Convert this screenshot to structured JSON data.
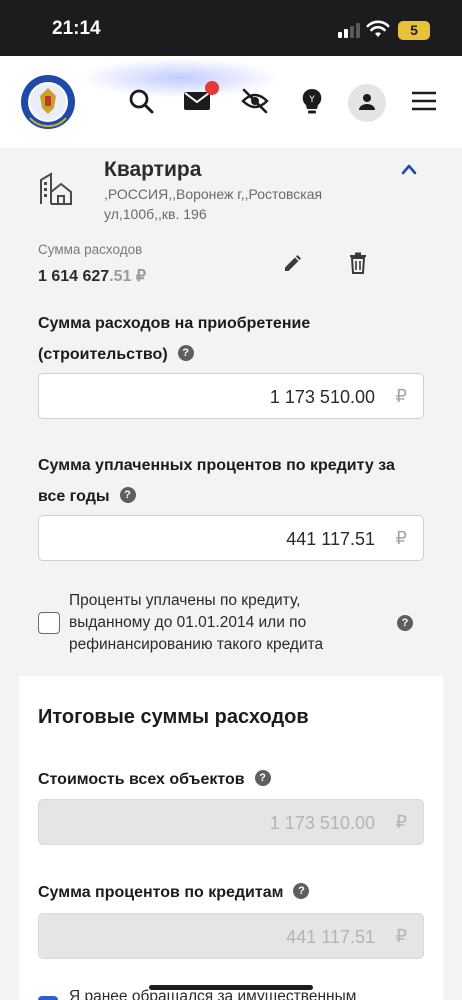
{
  "status_bar": {
    "time": "21:14",
    "battery": "5",
    "battery_color": "#e8c33a"
  },
  "header": {
    "logo": "fns-emblem-logo",
    "icons": [
      "search-icon",
      "mail-icon",
      "eye-off-icon",
      "lightbulb-icon",
      "user-icon",
      "menu-icon"
    ],
    "notification_color": "#e53935"
  },
  "property": {
    "title": "Квартира",
    "address": ",РОССИЯ,,Воронеж г,,Ростовская ул,100б,,кв. 196",
    "sum_label": "Сумма расходов",
    "sum_value_main": "1 614 627",
    "sum_value_decimals": ".51 ₽"
  },
  "fields": {
    "acquisition": {
      "label": "Сумма расходов на приобретение (строительство)",
      "value": "1 173 510.00",
      "currency": "₽"
    },
    "interest": {
      "label": "Сумма уплаченных процентов по кредиту за все годы",
      "value": "441 117.51",
      "currency": "₽"
    },
    "checkbox": {
      "label": "Проценты уплачены по кредиту, выданному до 01.01.2014 или по рефинансированию такого кредита",
      "checked": false
    }
  },
  "totals": {
    "title": "Итоговые суммы расходов",
    "all_objects": {
      "label": "Стоимость всех объектов",
      "value": "1 173 510.00",
      "currency": "₽"
    },
    "credit_interest": {
      "label": "Сумма процентов по кредитам",
      "value": "441 117.51",
      "currency": "₽"
    },
    "cut_text": "Я ранее обращался за имущественным"
  },
  "colors": {
    "accent_blue": "#2b5fd9",
    "panel_bg": "#f3f3f3"
  }
}
